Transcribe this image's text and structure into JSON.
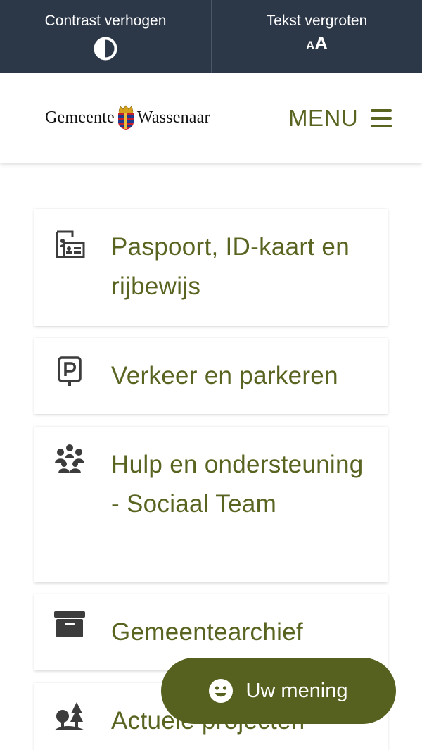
{
  "accessibility_bar": {
    "contrast_label": "Contrast verhogen",
    "textsize_label": "Tekst vergroten",
    "textsize_icon_small": "A",
    "textsize_icon_large": "A"
  },
  "header": {
    "logo_left": "Gemeente",
    "logo_right": "Wassenaar",
    "menu_label": "MENU"
  },
  "cards": [
    {
      "label": "Paspoort, ID-kaart en rijbewijs",
      "icon": "id-card-icon"
    },
    {
      "label": "Verkeer en parkeren",
      "icon": "parking-icon"
    },
    {
      "label": "Hulp en ondersteuning - Sociaal Team",
      "icon": "people-group-icon"
    },
    {
      "label": "Gemeentearchief",
      "icon": "archive-box-icon"
    },
    {
      "label": "Actuele projecten",
      "icon": "trees-icon"
    }
  ],
  "feedback": {
    "label": "Uw mening",
    "icon": "smiley-icon"
  },
  "colors": {
    "topbar_bg": "#2c3748",
    "accent_olive": "#5a6421",
    "feedback_bg": "#57611f"
  }
}
